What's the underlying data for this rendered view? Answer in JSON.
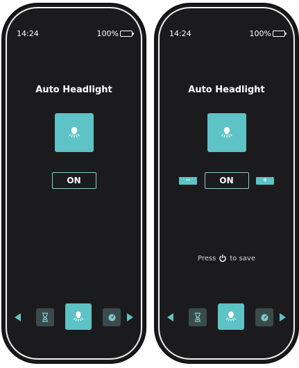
{
  "screens": [
    {
      "status": {
        "time": "14:24",
        "battery": "100%"
      },
      "title": "Auto Headlight",
      "main_icon": "headlight-icon",
      "value": "ON",
      "bottom_nav": {
        "items": [
          "hourglass-icon",
          "headlight-icon",
          "gauge-icon"
        ],
        "active": "headlight-icon"
      }
    },
    {
      "status": {
        "time": "14:24",
        "battery": "100%"
      },
      "title": "Auto Headlight",
      "main_icon": "headlight-icon",
      "value": "ON",
      "minus_label": "−",
      "plus_label": "+",
      "hint_before": "Press",
      "hint_icon": "power-icon",
      "hint_after": "to save",
      "bottom_nav": {
        "items": [
          "hourglass-icon",
          "headlight-icon",
          "gauge-icon"
        ],
        "active": "headlight-icon"
      }
    }
  ],
  "colors": {
    "accent": "#5ec3c6",
    "tile_inactive": "#3b4b4d",
    "screen_bg": "#1b1b1d"
  }
}
